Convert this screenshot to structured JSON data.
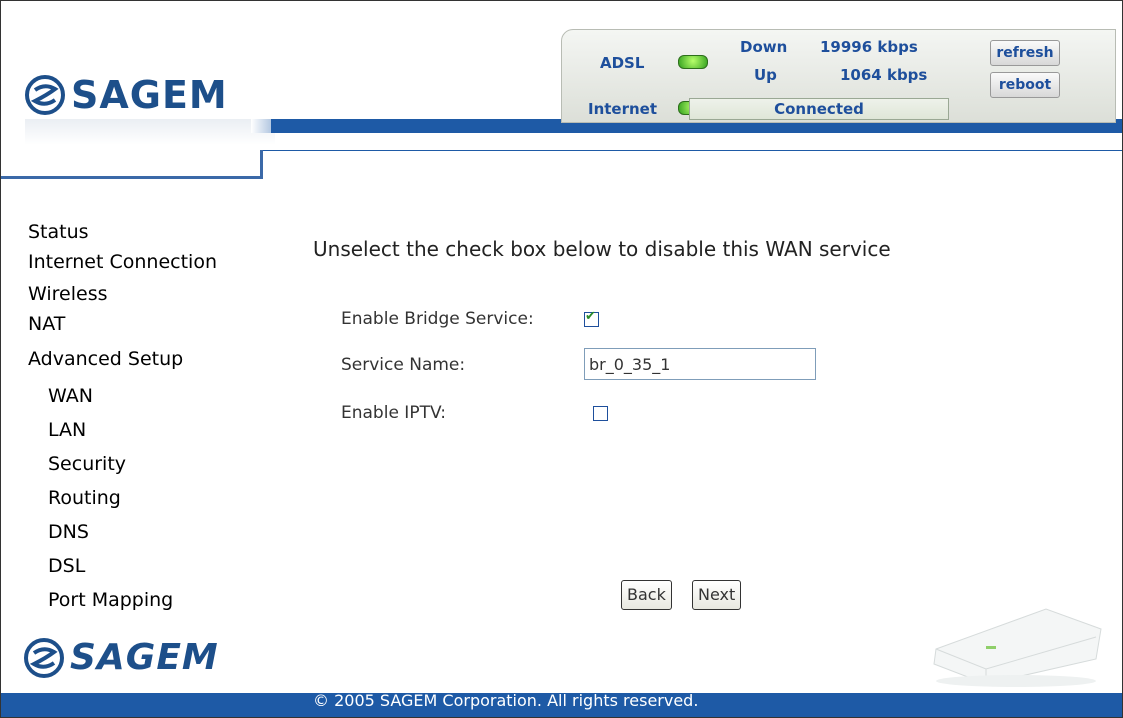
{
  "brand": {
    "logo_text": "SAGEM"
  },
  "status_panel": {
    "adsl_label": "ADSL",
    "internet_label": "Internet",
    "down_label": "Down",
    "down_value": "19996 kbps",
    "up_label": "Up",
    "up_value": "1064 kbps",
    "connection_status": "Connected",
    "refresh_label": "refresh",
    "reboot_label": "reboot",
    "led_color": "#33a11f"
  },
  "sidebar": {
    "items": [
      {
        "label": "Status"
      },
      {
        "label": "Internet Connection"
      },
      {
        "label": "Wireless"
      },
      {
        "label": "NAT"
      },
      {
        "label": "Advanced Setup"
      },
      {
        "label": "WAN"
      },
      {
        "label": "LAN"
      },
      {
        "label": "Security"
      },
      {
        "label": "Routing"
      },
      {
        "label": "DNS"
      },
      {
        "label": "DSL"
      },
      {
        "label": "Port Mapping"
      }
    ]
  },
  "main": {
    "instruction": "Unselect the check box below to disable this WAN service",
    "enable_bridge_label": "Enable Bridge Service:",
    "enable_bridge_checked": true,
    "service_name_label": "Service Name:",
    "service_name_value": "br_0_35_1",
    "enable_iptv_label": "Enable IPTV:",
    "enable_iptv_checked": false,
    "back_label": "Back",
    "next_label": "Next"
  },
  "footer": {
    "copyright": "© 2005 SAGEM Corporation. All rights reserved."
  },
  "colors": {
    "brand_blue": "#1e5aa6",
    "label_blue": "#1e4f9c"
  }
}
